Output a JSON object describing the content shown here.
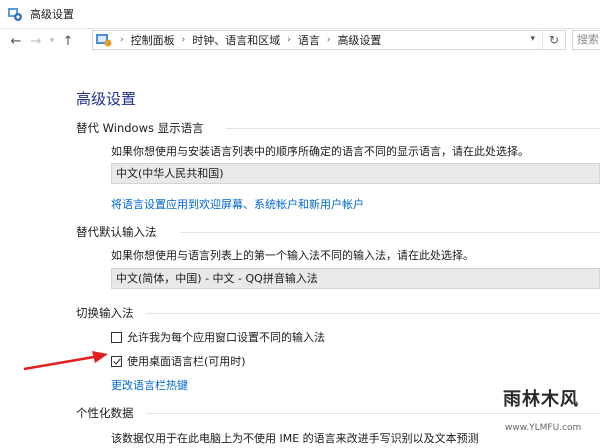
{
  "window": {
    "title": "高级设置"
  },
  "address_bar": {
    "breadcrumbs": [
      "控制面板",
      "时钟、语言和区域",
      "语言",
      "高级设置"
    ],
    "search_placeholder": "搜索"
  },
  "page": {
    "title": "高级设置",
    "display_language": {
      "heading": "替代 Windows 显示语言",
      "description": "如果你想使用与安装语言列表中的顺序所确定的语言不同的显示语言，请在此处选择。",
      "selected": "中文(中华人民共和国)",
      "link": "将语言设置应用到欢迎屏幕、系统帐户和新用户帐户"
    },
    "default_input": {
      "heading": "替代默认输入法",
      "description": "如果你想使用与语言列表上的第一个输入法不同的输入法，请在此处选择。",
      "selected": "中文(简体，中国) - 中文 - QQ拼音输入法"
    },
    "switch_input": {
      "heading": "切换输入法",
      "option_per_app": {
        "label": "允许我为每个应用窗口设置不同的输入法",
        "checked": false
      },
      "option_language_bar": {
        "label": "使用桌面语言栏(可用时)",
        "checked": true
      },
      "link": "更改语言栏热键"
    },
    "personalization": {
      "heading": "个性化数据",
      "description": "该数据仅用于在此电脑上为不使用 IME 的语言来改进手写识别以及文本预测"
    }
  },
  "watermark": {
    "logo": "雨林木风",
    "url": "www.YLMFU.com"
  },
  "colors": {
    "accent": "#1e3287",
    "link": "#0066cc",
    "arrow": "#e02020"
  }
}
